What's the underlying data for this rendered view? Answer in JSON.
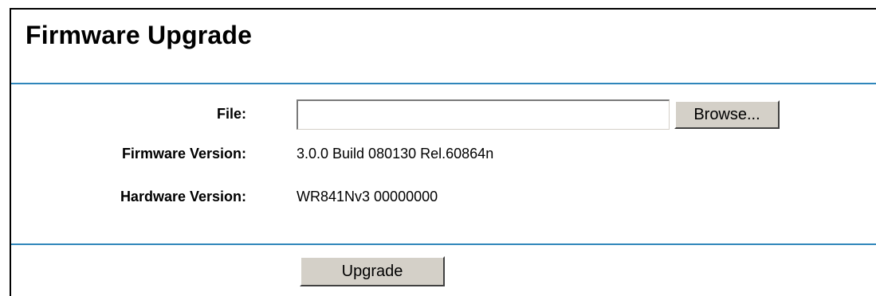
{
  "page": {
    "title": "Firmware Upgrade"
  },
  "form": {
    "file_label": "File:",
    "file_value": "",
    "browse_label": "Browse...",
    "firmware_label": "Firmware Version:",
    "firmware_value": "3.0.0 Build 080130 Rel.60864n",
    "hardware_label": "Hardware Version:",
    "hardware_value": "WR841Nv3 00000000",
    "upgrade_label": "Upgrade"
  },
  "colors": {
    "rule": "#2f86bb",
    "button_face": "#d4d0c8"
  }
}
